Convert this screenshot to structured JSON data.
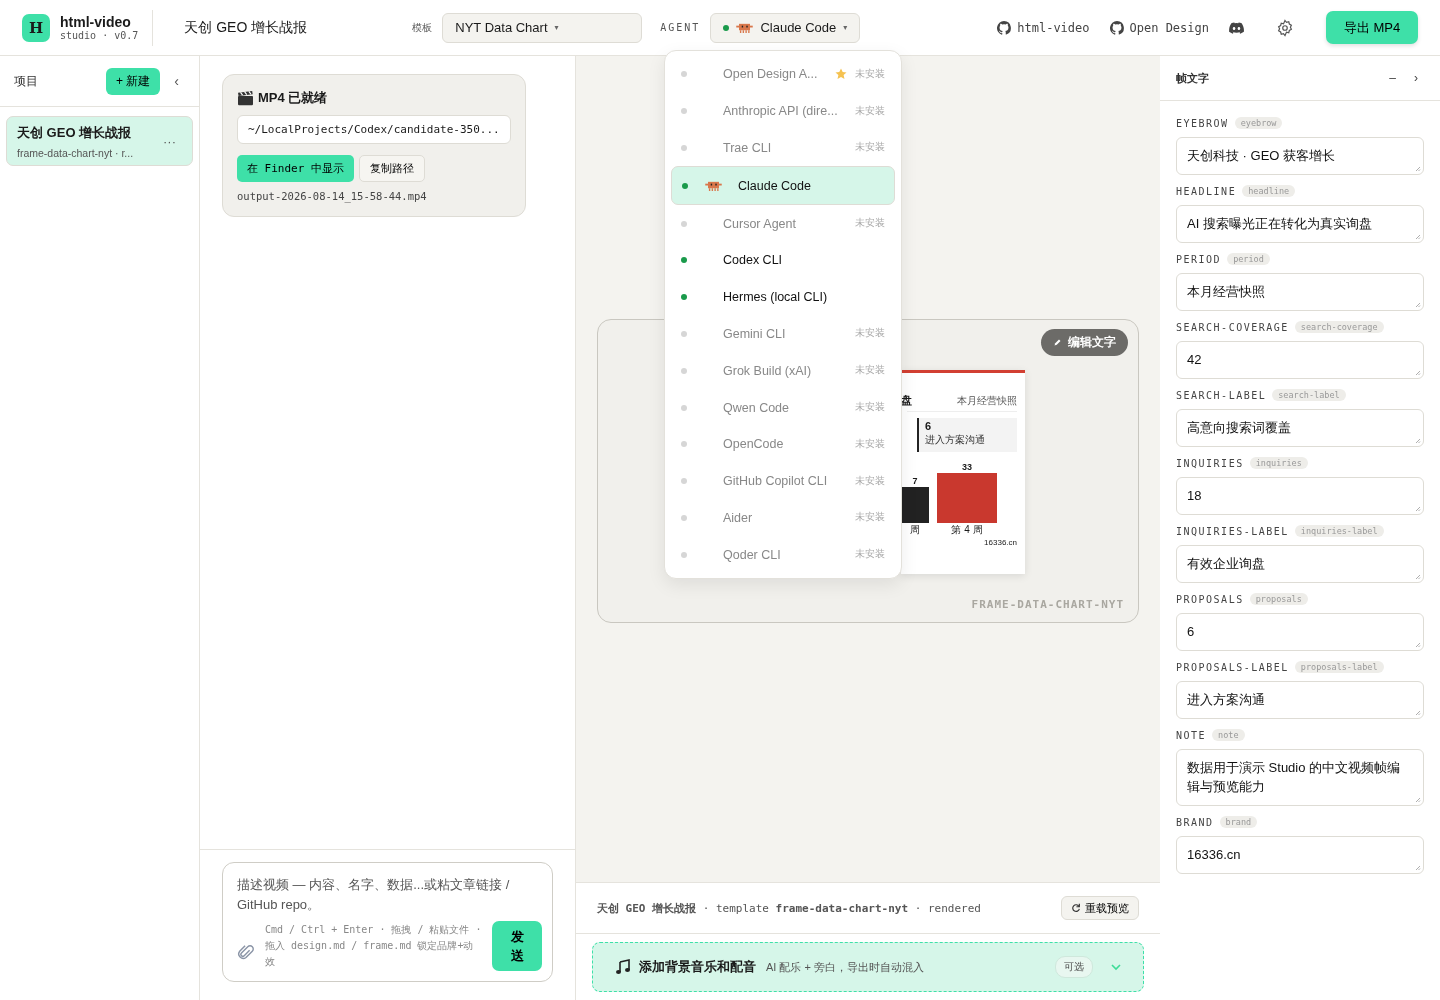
{
  "header": {
    "logo": "H",
    "app_name": "html-video",
    "version": "studio · v0.7",
    "project_title": "天创 GEO 增长战报",
    "template_label": "模板",
    "template_value": "NYT Data Chart",
    "caret": "▾",
    "agent_label": "AGENT",
    "agent_value": "Claude Code",
    "agent_installed": true,
    "links": [
      "html-video",
      "Open Design"
    ],
    "export_button": "导出 MP4"
  },
  "agent_menu": [
    {
      "name": "Open Design A...",
      "installed": false,
      "starred": true,
      "selected": false,
      "status": "未安装"
    },
    {
      "name": "Anthropic API (dire...",
      "installed": false,
      "starred": false,
      "selected": false,
      "status": "未安装"
    },
    {
      "name": "Trae CLI",
      "installed": false,
      "starred": false,
      "selected": false,
      "status": "未安装"
    },
    {
      "name": "Claude Code",
      "installed": true,
      "starred": false,
      "selected": true,
      "kind": "claude"
    },
    {
      "name": "Cursor Agent",
      "installed": false,
      "starred": false,
      "selected": false,
      "status": "未安装"
    },
    {
      "name": "Codex CLI",
      "installed": true,
      "starred": false,
      "selected": false
    },
    {
      "name": "Hermes (local CLI)",
      "installed": true,
      "starred": false,
      "selected": false
    },
    {
      "name": "Gemini CLI",
      "installed": false,
      "starred": false,
      "selected": false,
      "status": "未安装"
    },
    {
      "name": "Grok Build (xAI)",
      "installed": false,
      "starred": false,
      "selected": false,
      "status": "未安装"
    },
    {
      "name": "Qwen Code",
      "installed": false,
      "starred": false,
      "selected": false,
      "status": "未安装"
    },
    {
      "name": "OpenCode",
      "installed": false,
      "starred": false,
      "selected": false,
      "status": "未安装"
    },
    {
      "name": "GitHub Copilot CLI",
      "installed": false,
      "starred": false,
      "selected": false,
      "status": "未安装"
    },
    {
      "name": "Aider",
      "installed": false,
      "starred": false,
      "selected": false,
      "status": "未安装"
    },
    {
      "name": "Qoder CLI",
      "installed": false,
      "starred": false,
      "selected": false,
      "status": "未安装"
    }
  ],
  "sidebar": {
    "title": "项目",
    "new_button": "+ 新建",
    "collapse": "‹",
    "projects": [
      {
        "title": "天创 GEO 增长战报",
        "subtitle": "frame-data-chart-nyt · r...",
        "more": "···",
        "selected": true
      }
    ]
  },
  "export_card": {
    "title": "MP4 已就绪",
    "path": "~/LocalProjects/Codex/candidate-350...",
    "reveal_button": "在 Finder 中显示",
    "copy_button": "复制路径",
    "filename": "output-2026-08-14_15-58-44.mp4"
  },
  "composer": {
    "placeholder": "描述视频 — 内容、名字、数据...或粘文章链接 / GitHub repo。",
    "hint": "Cmd / Ctrl + Enter · 拖拽 / 粘贴文件 · 拖入 design.md / frame.md 锁定品牌+动效",
    "send_button": "发送"
  },
  "preview": {
    "edit_button": "编辑文字",
    "watermark": "FRAME-DATA-CHART-NYT",
    "slide": {
      "headline_tail": "盘",
      "period": "本月经营快照",
      "stat_value": "6",
      "stat_label": "进入方案沟通",
      "bar_labels": [
        "7",
        "33"
      ],
      "bar_categories": [
        "周",
        "第 4 周"
      ],
      "brand": "16336.cn"
    }
  },
  "status_bar": {
    "text": "**天创 GEO 增长战报** · template **frame-data-chart-nyt** · rendered",
    "reload_button": "重载预览"
  },
  "music_banner": {
    "title": "添加背景音乐和配音",
    "subtitle": "AI 配乐 + 旁白，导出时自动混入",
    "badge": "可选",
    "expanded": false
  },
  "frame_text": {
    "title": "帧文字",
    "minimize": "–",
    "close": "›",
    "fields": [
      {
        "label": "EYEBROW",
        "key": "eyebrow",
        "value": "天创科技 · GEO 获客增长"
      },
      {
        "label": "HEADLINE",
        "key": "headline",
        "value": "AI 搜索曝光正在转化为真实询盘"
      },
      {
        "label": "PERIOD",
        "key": "period",
        "value": "本月经营快照"
      },
      {
        "label": "SEARCH-COVERAGE",
        "key": "search-coverage",
        "value": "42"
      },
      {
        "label": "SEARCH-LABEL",
        "key": "search-label",
        "value": "高意向搜索词覆盖"
      },
      {
        "label": "INQUIRIES",
        "key": "inquiries",
        "value": "18"
      },
      {
        "label": "INQUIRIES-LABEL",
        "key": "inquiries-label",
        "value": "有效企业询盘"
      },
      {
        "label": "PROPOSALS",
        "key": "proposals",
        "value": "6"
      },
      {
        "label": "PROPOSALS-LABEL",
        "key": "proposals-label",
        "value": "进入方案沟通"
      },
      {
        "label": "NOTE",
        "key": "note",
        "value": "数据用于演示 Studio 的中文视频帧编辑与预览能力"
      },
      {
        "label": "BRAND",
        "key": "brand",
        "value": "16336.cn"
      }
    ]
  }
}
